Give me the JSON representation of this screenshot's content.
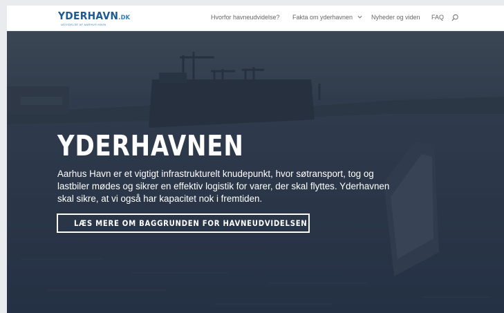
{
  "logo": {
    "main": "YDERHAVN",
    "tld": ".DK",
    "tagline": "UDVIDELSE AF AARHUS HAVN"
  },
  "nav": {
    "items": [
      {
        "label": "Hvorfor havneudvidelse?"
      },
      {
        "label": "Fakta om yderhavnen",
        "has_dropdown": true
      },
      {
        "label": "Nyheder og viden"
      },
      {
        "label": "FAQ"
      }
    ],
    "search_icon": "search-icon"
  },
  "hero": {
    "title": "YDERHAVNEN",
    "text": "Aarhus Havn er et vigtigt infrastrukturelt knudepunkt, hvor søtransport, tog og lastbiler mødes og sikrer en effektiv logistik for varer, der skal flyttes. Yderhavnen skal sikre, at vi også har kapacitet nok i fremtiden.",
    "button_label": "LÆS MERE OM BAGGRUNDEN FOR HAVNEUDVIDELSEN"
  },
  "colors": {
    "brand_blue": "#1d5a93",
    "hero_overlay": "#2f3b4b",
    "nav_text": "#666666"
  }
}
